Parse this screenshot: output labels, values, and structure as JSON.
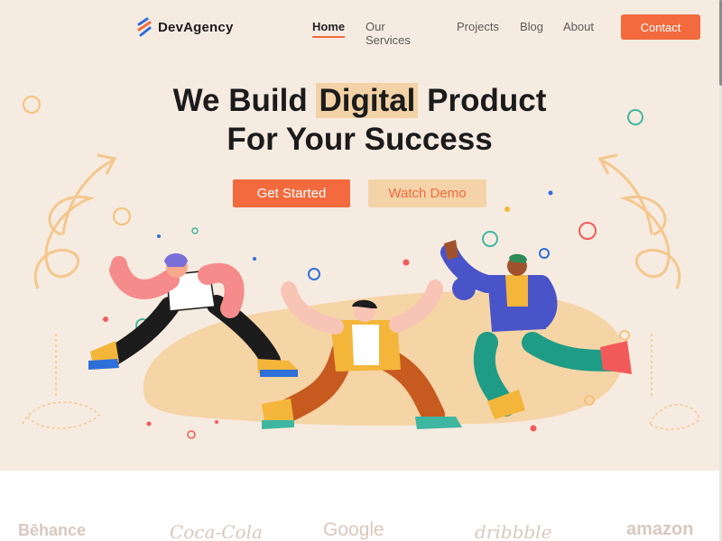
{
  "brand": {
    "name": "DevAgency",
    "logo_icon": "lightning-stripes-icon"
  },
  "nav": {
    "items": [
      {
        "label": "Home",
        "active": true
      },
      {
        "label": "Our Services"
      },
      {
        "label": "Projects"
      },
      {
        "label": "Blog"
      },
      {
        "label": "About"
      }
    ],
    "contact_label": "Contact"
  },
  "hero": {
    "title_line1_pre": "We Build ",
    "title_line1_highlight": "Digital",
    "title_line1_post": " Product",
    "title_line2": "For Your Success",
    "primary_cta": "Get Started",
    "secondary_cta": "Watch Demo",
    "illustration": "three-people-jumping-celebrating"
  },
  "partners": [
    "Bēhance",
    "Coca-Cola",
    "Google",
    "dribbble",
    "amazon"
  ],
  "colors": {
    "accent": "#f26a3d",
    "highlight": "#f2d2a6",
    "hero_background": "#f6ebe0",
    "heading": "#1b1b1b"
  }
}
